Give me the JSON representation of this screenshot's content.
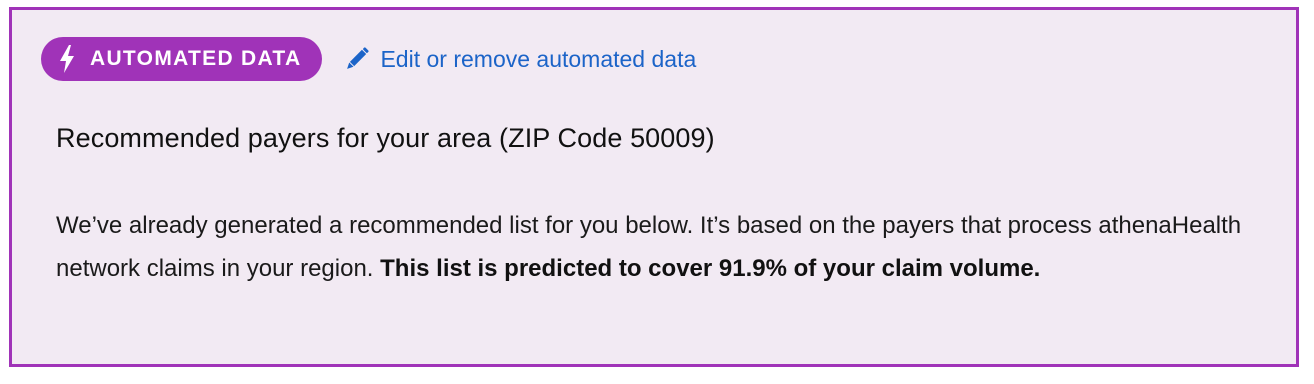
{
  "badge": {
    "icon": "lightning-bolt-icon",
    "label": "AUTOMATED DATA",
    "color": "#a033b8"
  },
  "edit_link": {
    "icon": "pencil-icon",
    "label": "Edit or remove automated data",
    "color": "#1c64c8"
  },
  "panel": {
    "border_color": "#a033b8",
    "background": "#f2eaf3"
  },
  "heading": "Recommended payers for your area (ZIP Code 50009)",
  "description": {
    "text": "We’ve already generated a recommended list for you below. It’s based on the payers that process athenaHealth network claims in your region.  ",
    "emphasis": "This list is predicted to cover 91.9% of your claim volume."
  }
}
